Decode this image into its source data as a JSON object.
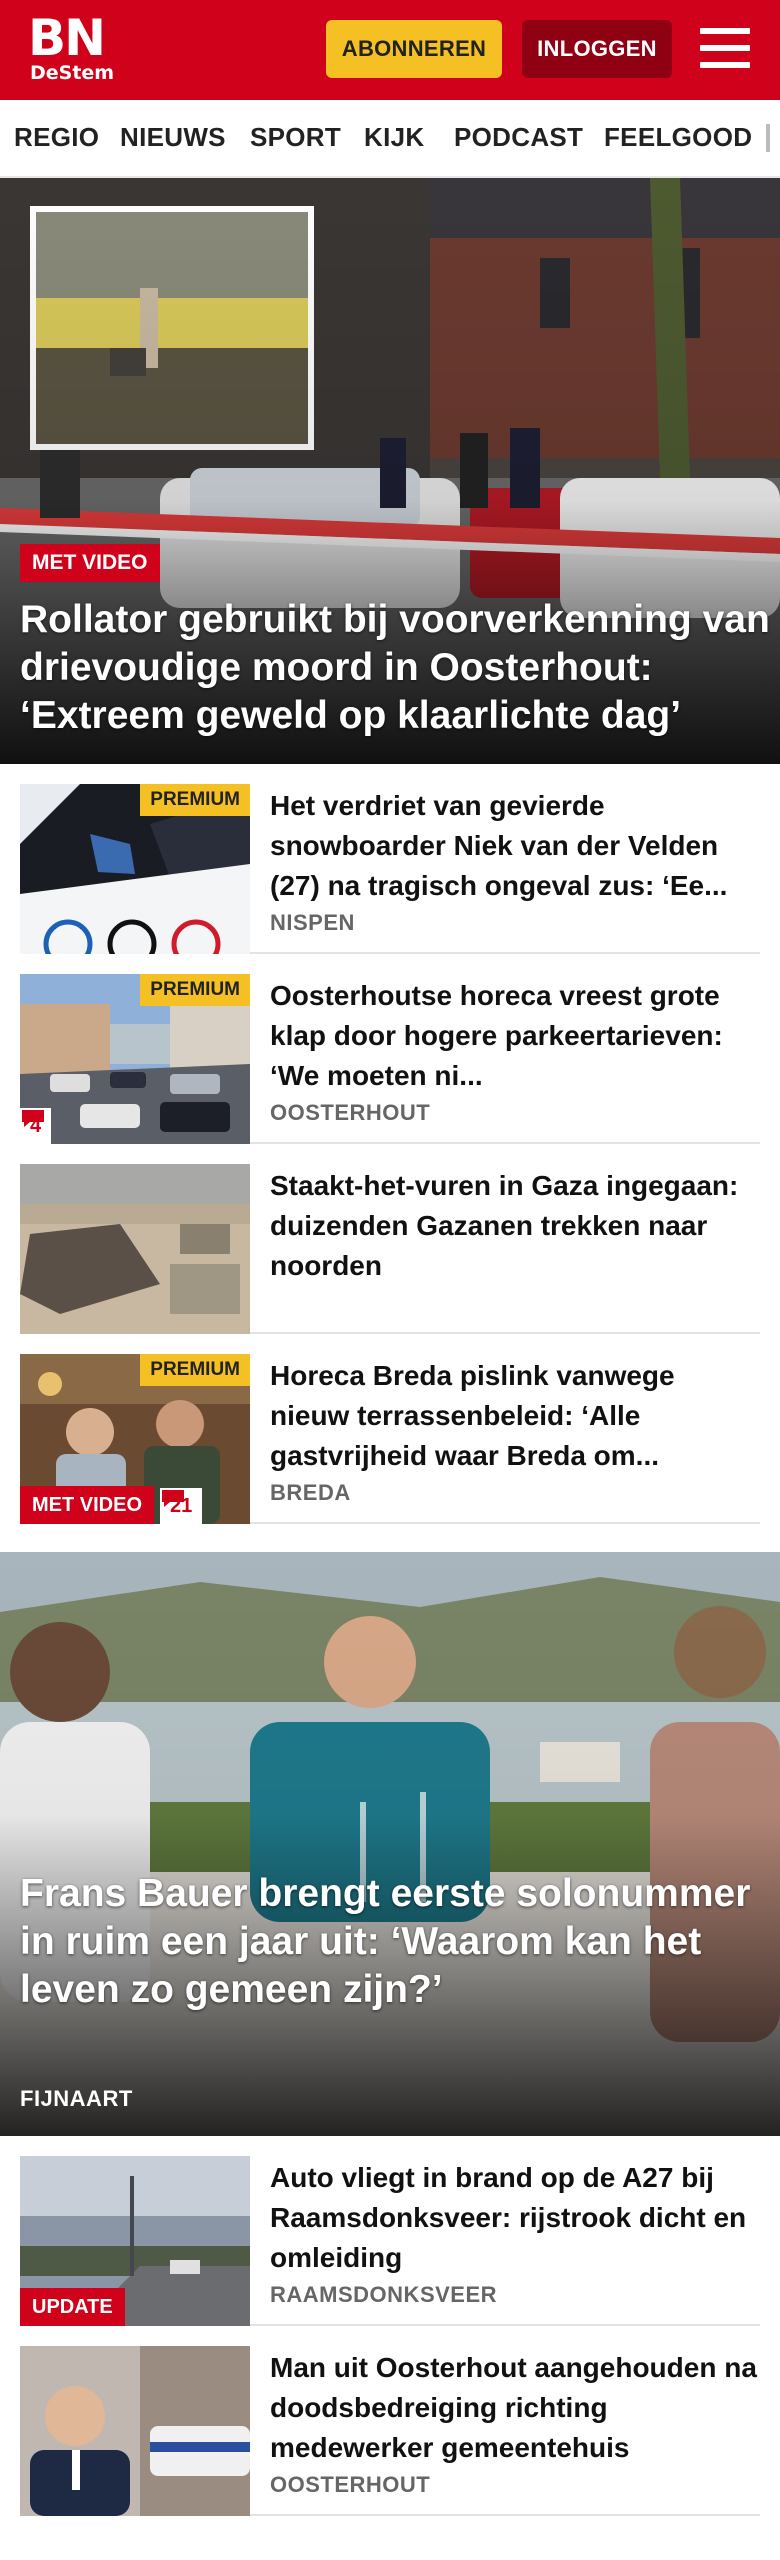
{
  "header": {
    "logo": "BN",
    "logo_sub": "DeStem",
    "subscribe_label": "ABONNEREN",
    "login_label": "INLOGGEN",
    "brand_color": "#d0021b",
    "menu_icon": "hamburger-menu-icon"
  },
  "nav": {
    "items": [
      {
        "label": "REGIO"
      },
      {
        "label": "NIEUWS"
      },
      {
        "label": "SPORT"
      },
      {
        "label": "KIJK"
      },
      {
        "label": "PODCAST"
      },
      {
        "label": "FEELGOOD"
      }
    ]
  },
  "hero": {
    "badge": "MET VIDEO",
    "title": "Rollator gebruikt bij voorverkenning van drievoudige moord in Oosterhout: ‘Extreem geweld op klaarlichte dag’"
  },
  "articles": [
    {
      "premium": "PREMIUM",
      "title": "Het verdriet van gevierde snowboarder Niek van der Velden (27) na tragisch ongeval zus: ‘Ee...",
      "location": "NISPEN"
    },
    {
      "premium": "PREMIUM",
      "comments": "4",
      "title": "Oosterhoutse horeca vreest grote klap door hogere parkeertarieven: ‘We moeten ni...",
      "location": "OOSTERHOUT"
    },
    {
      "title": "Staakt-het-vuren in Gaza ingegaan: duizenden Gazanen trekken naar noorden"
    },
    {
      "premium": "PREMIUM",
      "label": "MET VIDEO",
      "comments": "21",
      "title": "Horeca Breda pislink vanwege nieuw terrassenbeleid: ‘Alle gastvrijheid waar Breda om...",
      "location": "BREDA"
    }
  ],
  "feature": {
    "title": "Frans Bauer brengt eerste solonummer in ruim een jaar uit: ‘Waarom kan het leven zo gemeen zijn?’",
    "location": "FIJNAART"
  },
  "articles2": [
    {
      "label": "UPDATE",
      "title": "Auto vliegt in brand op de A27 bij Raamsdonksveer: rijstrook dicht en omleiding",
      "location": "RAAMSDONKSVEER"
    },
    {
      "title": "Man uit Oosterhout aangehouden na doodsbedreiging richting medewerker gemeentehuis",
      "location": "OOSTERHOUT"
    }
  ]
}
